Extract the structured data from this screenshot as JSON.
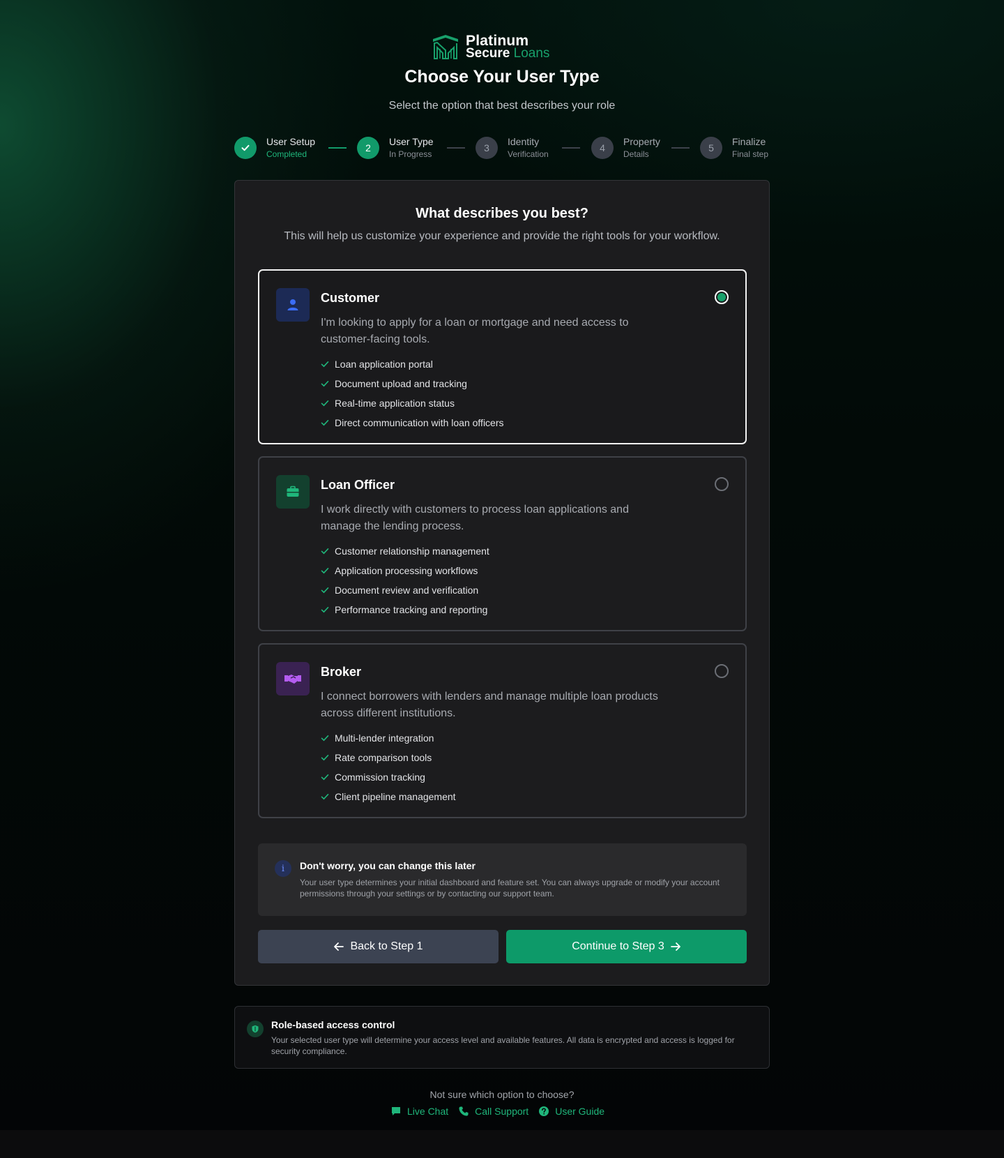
{
  "brand": {
    "name_line1": "Platinum",
    "name_line2a": "Secure",
    "name_line2b": "Loans",
    "accent_color": "#18a06b"
  },
  "header": {
    "title": "Choose Your User Type",
    "subtitle": "Select the option that best describes your role"
  },
  "stepper": {
    "steps": [
      {
        "number": "✓",
        "title": "User Setup",
        "status": "Completed",
        "state": "completed"
      },
      {
        "number": "2",
        "title": "User Type",
        "status": "In Progress",
        "state": "active"
      },
      {
        "number": "3",
        "title": "Identity",
        "status": "Verification",
        "state": "pending"
      },
      {
        "number": "4",
        "title": "Property",
        "status": "Details",
        "state": "pending"
      },
      {
        "number": "5",
        "title": "Finalize",
        "status": "Final step",
        "state": "pending"
      }
    ]
  },
  "panel": {
    "title": "What describes you best?",
    "subtitle": "This will help us customize your experience and provide the right tools for your workflow."
  },
  "options": [
    {
      "icon": "user-icon",
      "title": "Customer",
      "description": "I'm looking to apply for a loan or mortgage and need access to customer-facing tools.",
      "selected": true,
      "features": [
        "Loan application portal",
        "Document upload and tracking",
        "Real-time application status",
        "Direct communication with loan officers"
      ]
    },
    {
      "icon": "briefcase-icon",
      "title": "Loan Officer",
      "description": "I work directly with customers to process loan applications and manage the lending process.",
      "selected": false,
      "features": [
        "Customer relationship management",
        "Application processing workflows",
        "Document review and verification",
        "Performance tracking and reporting"
      ]
    },
    {
      "icon": "handshake-icon",
      "title": "Broker",
      "description": "I connect borrowers with lenders and manage multiple loan products across different institutions.",
      "selected": false,
      "features": [
        "Multi-lender integration",
        "Rate comparison tools",
        "Commission tracking",
        "Client pipeline management"
      ]
    }
  ],
  "notice": {
    "icon": "info-icon",
    "title": "Don't worry, you can change this later",
    "text": "Your user type determines your initial dashboard and feature set. You can always upgrade or modify your account permissions through your settings or by contacting our support team."
  },
  "actions": {
    "back_label": "Back to Step 1",
    "next_label": "Continue to Step 3"
  },
  "security": {
    "icon": "shield-icon",
    "title": "Role-based access control",
    "text": "Your selected user type will determine your access level and available features. All data is encrypted and access is logged for security compliance."
  },
  "help": {
    "question": "Not sure which option to choose?",
    "links": [
      {
        "icon": "chat-icon",
        "label": "Live Chat"
      },
      {
        "icon": "phone-icon",
        "label": "Call Support"
      },
      {
        "icon": "question-icon",
        "label": "User Guide"
      }
    ]
  }
}
